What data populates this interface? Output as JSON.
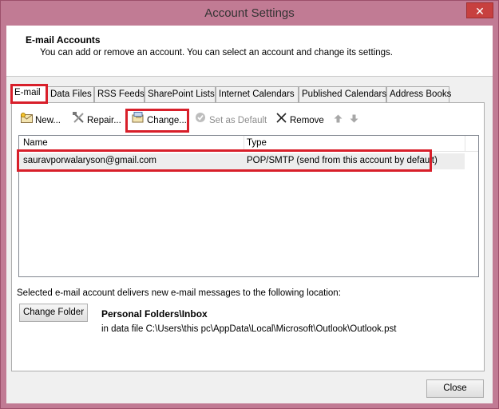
{
  "window": {
    "title": "Account Settings",
    "close_glyph": "✕"
  },
  "header": {
    "title": "E-mail Accounts",
    "description": "You can add or remove an account. You can select an account and change its settings."
  },
  "tabs": [
    {
      "label": "E-mail",
      "active": true
    },
    {
      "label": "Data Files"
    },
    {
      "label": "RSS Feeds"
    },
    {
      "label": "SharePoint Lists"
    },
    {
      "label": "Internet Calendars"
    },
    {
      "label": "Published Calendars"
    },
    {
      "label": "Address Books"
    }
  ],
  "toolbar": {
    "new_label": "New...",
    "repair_label": "Repair...",
    "change_label": "Change...",
    "set_default_label": "Set as Default",
    "remove_label": "Remove"
  },
  "list": {
    "columns": [
      "Name",
      "Type"
    ],
    "rows": [
      {
        "name": "sauravporwalaryson@gmail.com",
        "type": "POP/SMTP (send from this account by default)"
      }
    ]
  },
  "delivery": {
    "text": "Selected e-mail account delivers new e-mail messages to the following location:",
    "change_folder_label": "Change Folder",
    "folder": "Personal Folders\\Inbox",
    "data_file": "in data file C:\\Users\\this pc\\AppData\\Local\\Microsoft\\Outlook\\Outlook.pst"
  },
  "footer": {
    "close_label": "Close"
  },
  "colors": {
    "highlight": "#d81f2a",
    "frame": "#c17b94"
  }
}
